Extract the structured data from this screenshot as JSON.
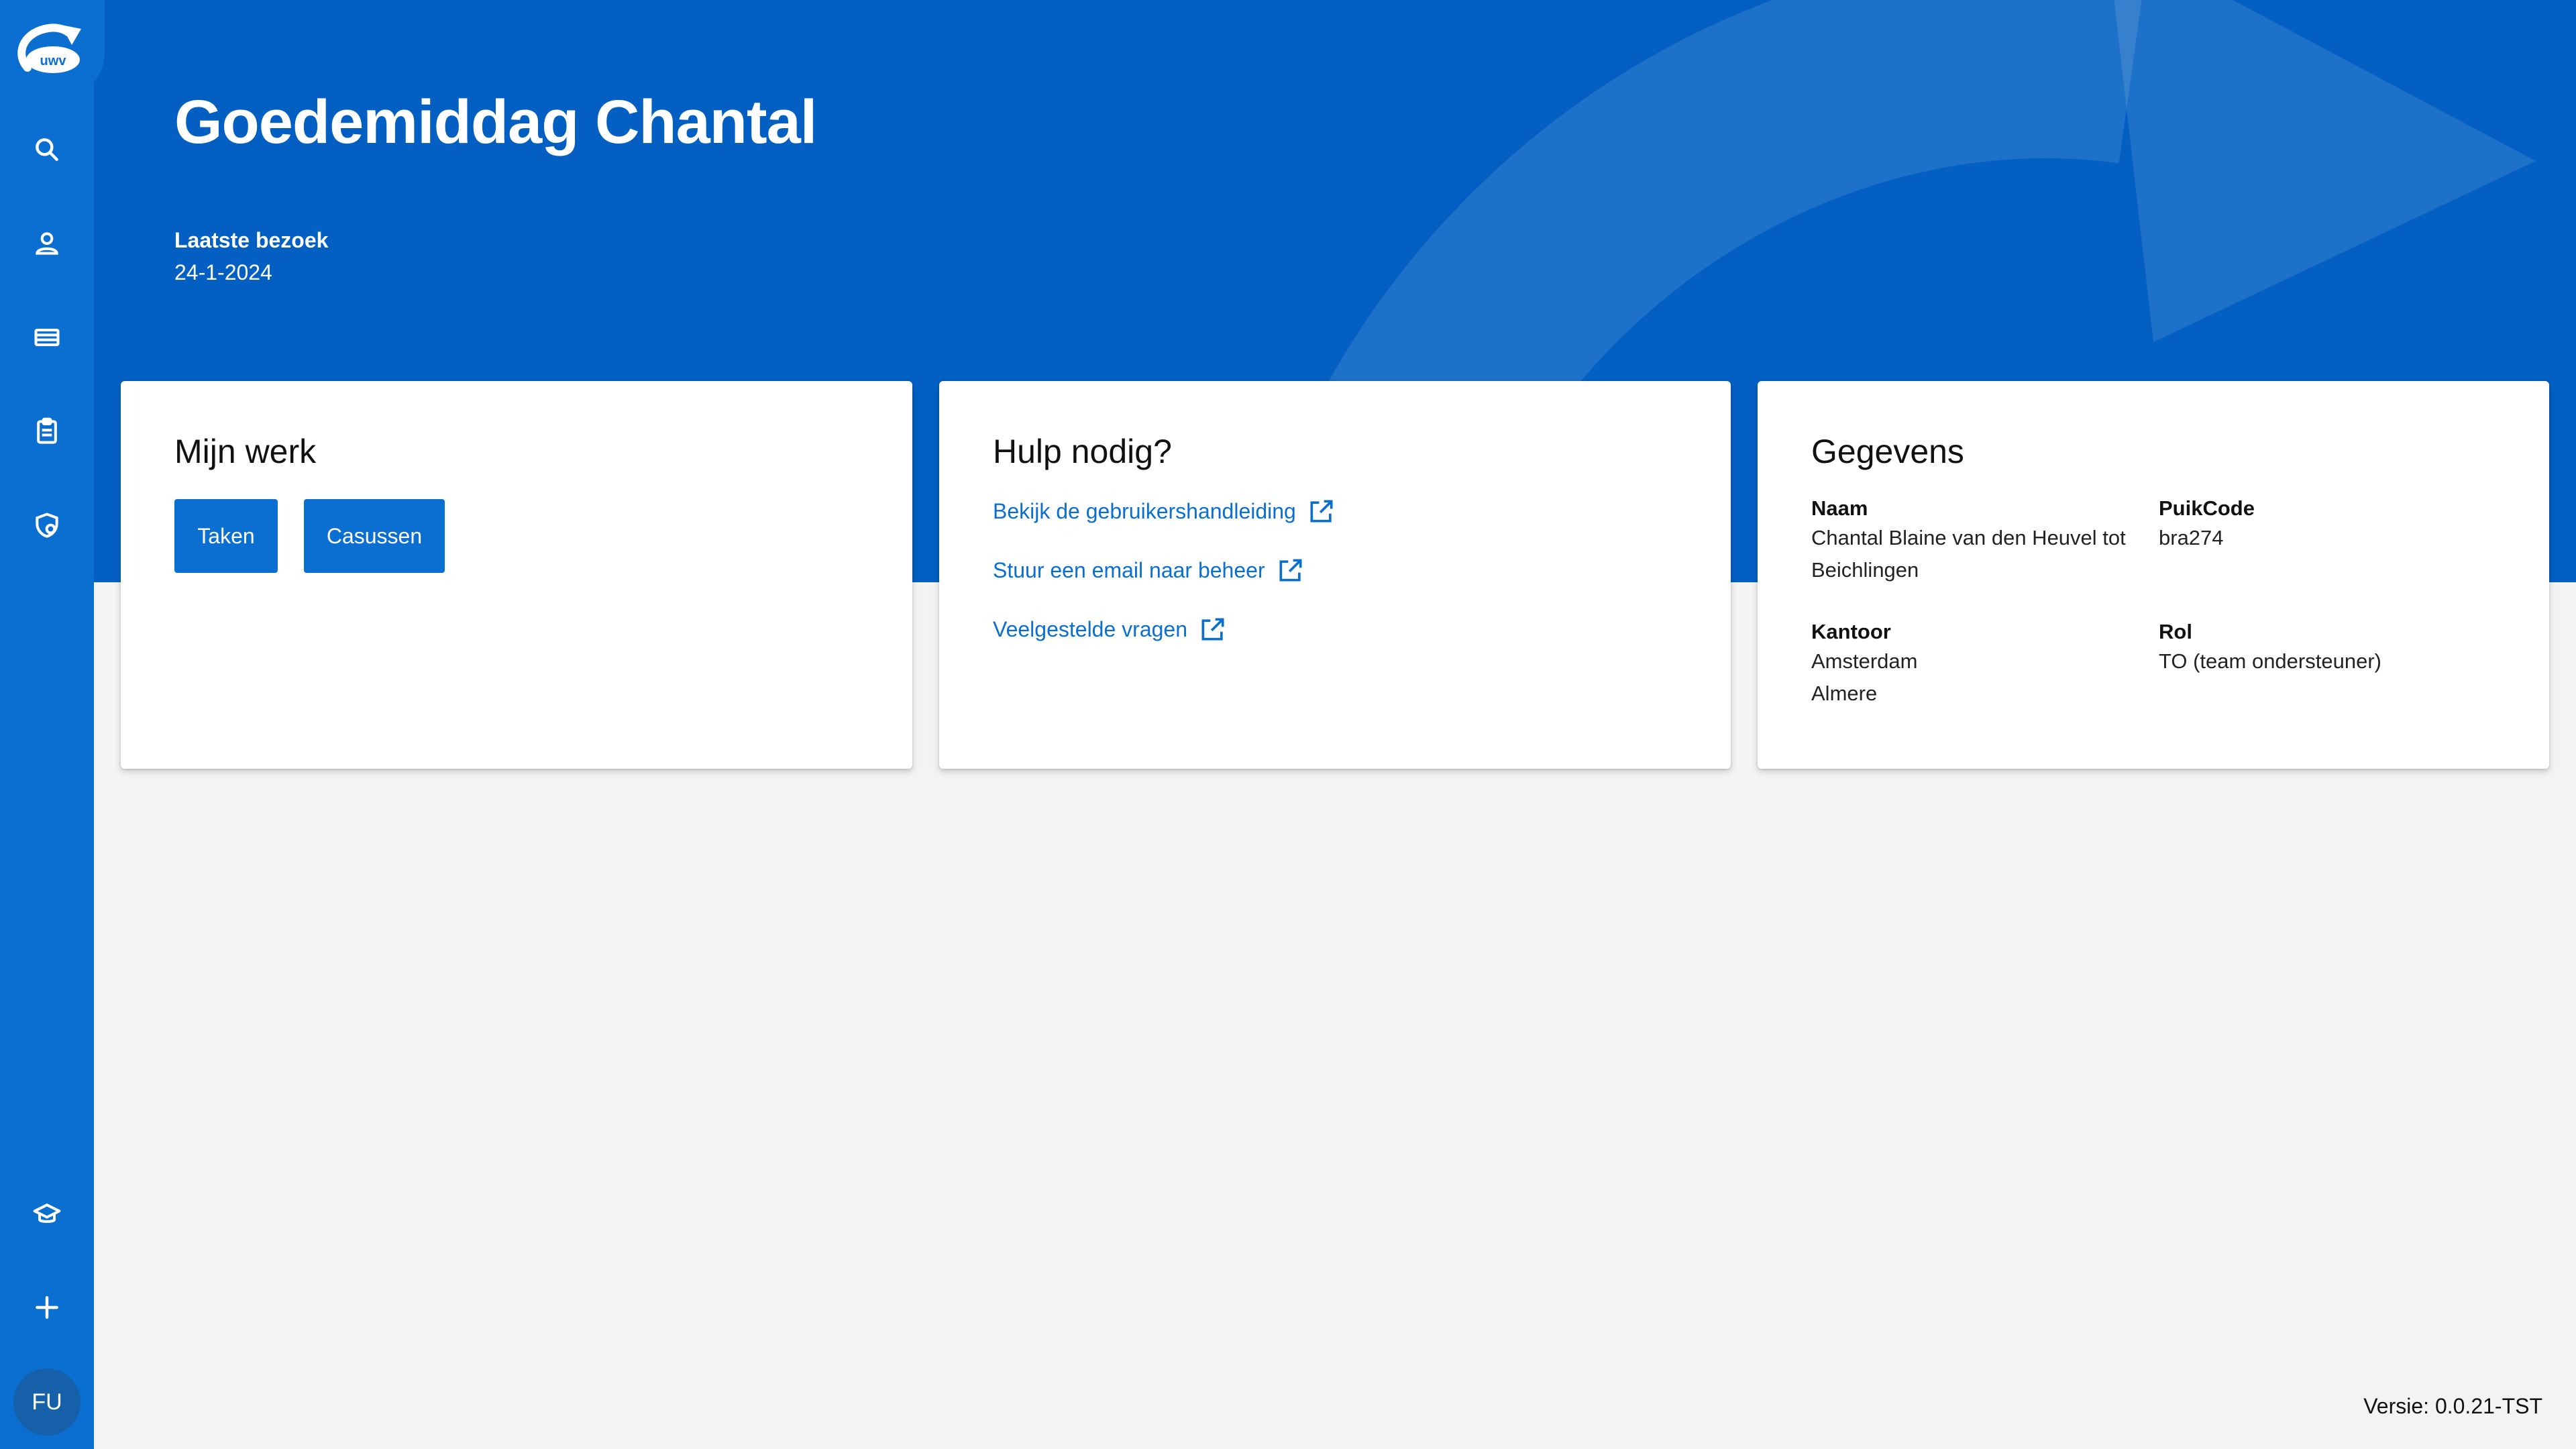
{
  "sidebar": {
    "logo_text": "uwv",
    "icons": [
      "search-icon",
      "person-icon",
      "card-icon",
      "clipboard-icon",
      "shield-icon",
      "graduation-cap-icon",
      "plus-icon"
    ],
    "avatar_initials": "FU"
  },
  "hero": {
    "greeting": "Goedemiddag Chantal",
    "last_visit_label": "Laatste bezoek",
    "last_visit_date": "24-1-2024"
  },
  "cards": {
    "work": {
      "title": "Mijn werk",
      "buttons": [
        "Taken",
        "Casussen"
      ]
    },
    "help": {
      "title": "Hulp nodig?",
      "links": [
        "Bekijk de gebruikershandleiding",
        "Stuur een email naar beheer",
        "Veelgestelde vragen"
      ]
    },
    "details": {
      "title": "Gegevens",
      "name_label": "Naam",
      "name_value": "Chantal Blaine van den Heuvel tot Beichlingen",
      "puik_label": "PuikCode",
      "puik_value": "bra274",
      "office_label": "Kantoor",
      "office_value": "Amsterdam Almere",
      "role_label": "Rol",
      "role_value": "TO (team ondersteuner)"
    }
  },
  "footer": {
    "version": "Versie: 0.0.21-TST"
  },
  "colors": {
    "primary": "#0a6fd0",
    "hero": "#0360c2",
    "background": "#f3f3f3"
  }
}
